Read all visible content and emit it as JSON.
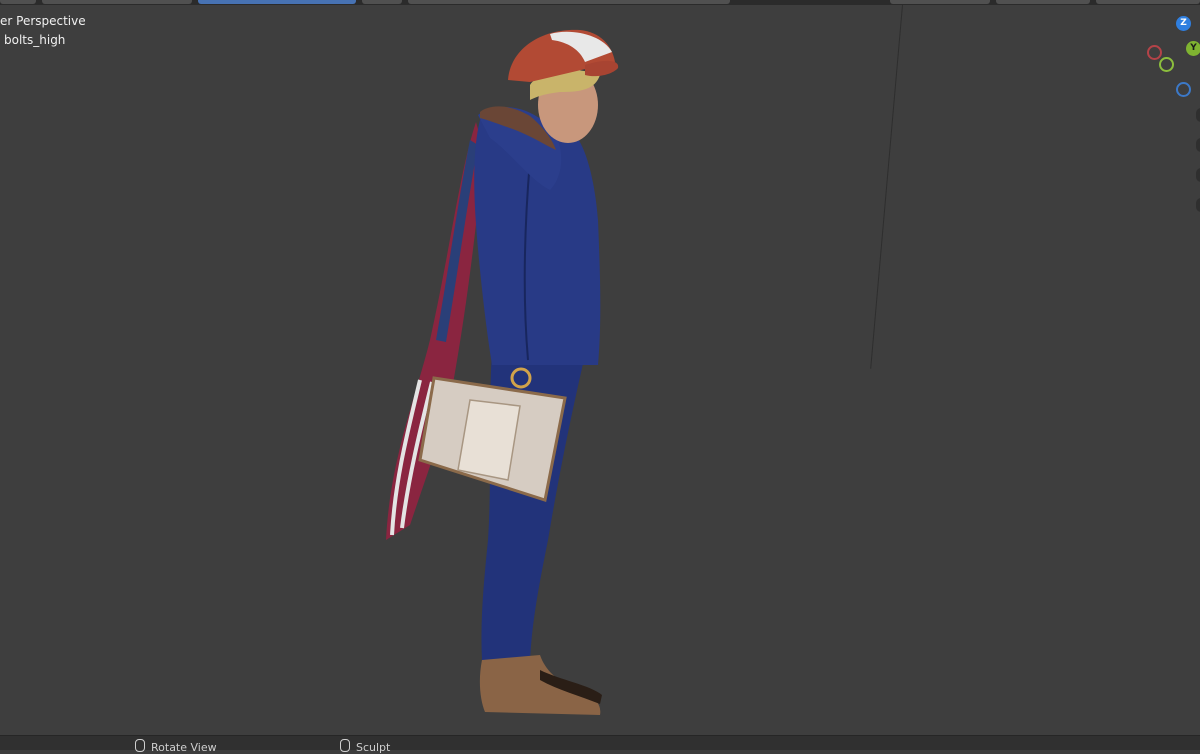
{
  "viewport": {
    "view_name": "er Perspective",
    "object_name": "bolts_high"
  },
  "gizmo": {
    "z_label": "Z",
    "y_label": "Y",
    "colors": {
      "x": "#b44348",
      "y": "#7fb331",
      "z": "#2f7fe0"
    }
  },
  "scene": {
    "icon": "sculpted-character-model"
  },
  "status_bar": {
    "rotate_label": "Rotate View",
    "rotate_icon": "mouse-middle-icon",
    "sculpt_label": "Sculpt",
    "sculpt_icon": "mouse-left-icon"
  }
}
